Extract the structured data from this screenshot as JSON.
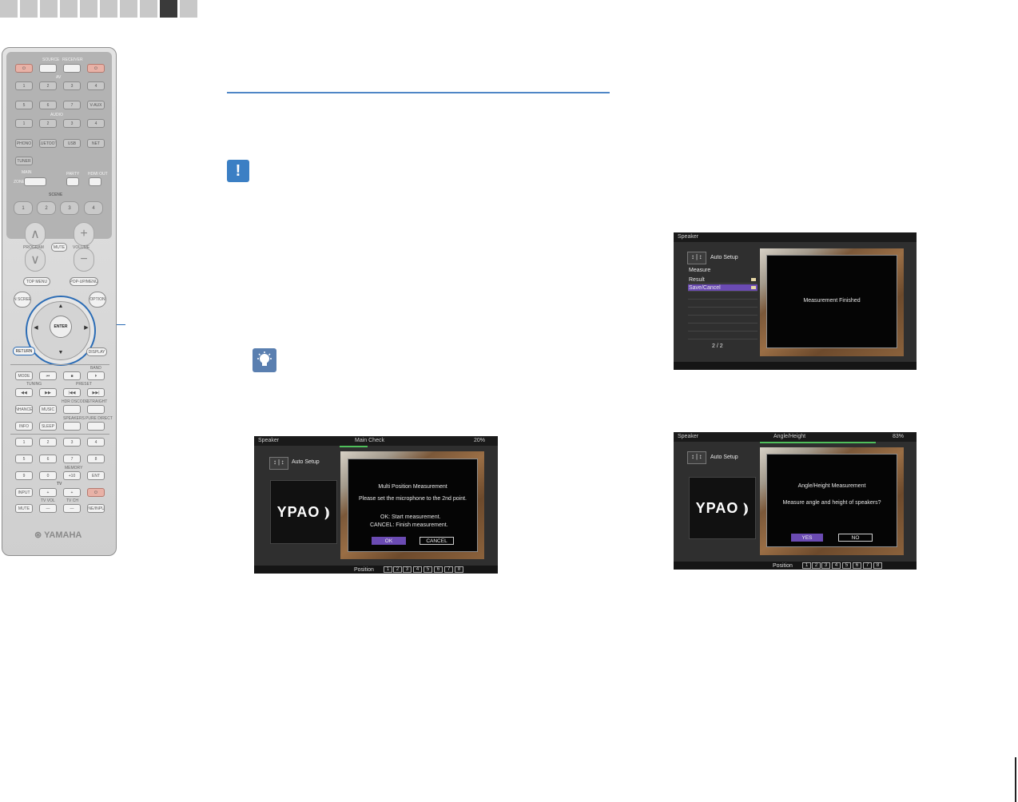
{
  "page": {
    "tabs_count": 10,
    "active_tab_index": 8,
    "accent_color": "#4f86c6"
  },
  "remote": {
    "brand": "YAMAHA",
    "labels": {
      "source": "SOURCE",
      "receiver": "RECEIVER",
      "av": "AV",
      "audio": "AUDIO",
      "scene": "SCENE",
      "program": "PROGRAM",
      "volume": "VOLUME",
      "mute": "MUTE",
      "tuning": "TUNING",
      "preset": "PRESET",
      "band": "BAND",
      "tv": "TV",
      "memory": "MEMORY",
      "tv_vol": "TV VOL",
      "tv_ch": "TV CH",
      "main": "MAIN",
      "zone": "ZONE",
      "party": "PARTY",
      "hdmi_out": "HDMI OUT",
      "hdr_dscode": "HDR DSCODE",
      "straight": "STRAIGHT",
      "speakers": "SPEAKERS",
      "pure_direct": "PURE DIRECT"
    },
    "av_buttons": [
      "1",
      "2",
      "3",
      "4",
      "5",
      "6",
      "7",
      "V-AUX"
    ],
    "audio_buttons": [
      "1",
      "2",
      "3",
      "4"
    ],
    "source_buttons": [
      "PHONO",
      "BLUETOOTH",
      "USB",
      "NET"
    ],
    "tuner_button": "TUNER",
    "scene_buttons": [
      "1",
      "2",
      "3",
      "4"
    ],
    "menu_buttons": {
      "top_menu": "TOP MENU",
      "popup_menu": "POP-UP/MENU",
      "on_screen": "ON SCREEN",
      "option": "OPTION",
      "enter": "ENTER",
      "return": "RETURN",
      "display": "DISPLAY"
    },
    "transport": [
      "MODE",
      "⏮",
      "■",
      "⏵"
    ],
    "tuning_row": [
      "◀◀",
      "▶▶",
      "|◀◀",
      "▶▶|"
    ],
    "sound_row": [
      "ENHANCER",
      "MUSIC",
      "",
      ""
    ],
    "info_row": [
      "INFO",
      "SLEEP",
      "",
      ""
    ],
    "num_rows": [
      [
        "1",
        "2",
        "3",
        "4"
      ],
      [
        "5",
        "6",
        "7",
        "8"
      ],
      [
        "9",
        "0",
        "+10",
        "ENT"
      ]
    ],
    "tv_row1": [
      "INPUT",
      "+",
      "+",
      "⏻"
    ],
    "tv_row2": [
      "MUTE",
      "—",
      "—",
      "LINE/INPUT"
    ]
  },
  "screens": {
    "left": {
      "header_left": "Speaker",
      "header_center": "Main Check",
      "header_right": "20%",
      "progress": 0.2,
      "menu_title": "Auto Setup",
      "logo": "YPAO",
      "panel_title": "Multi Position Measurement",
      "panel_line": "Please set the microphone to the 2nd point.",
      "ok_line": "OK:   Start measurement.",
      "cancel_line": "CANCEL:  Finish measurement.",
      "ok_button": "OK",
      "cancel_button": "CANCEL",
      "position_label": "Position",
      "positions": [
        "1",
        "2",
        "3",
        "4",
        "5",
        "6",
        "7",
        "8"
      ]
    },
    "top_right": {
      "header_left": "Speaker",
      "menu_title": "Auto Setup",
      "menu_items": [
        "Measure",
        "Result",
        "Save/Cancel"
      ],
      "page_indicator": "2 / 2",
      "panel_text": "Measurement Finished"
    },
    "bottom_right": {
      "header_left": "Speaker",
      "header_center": "Angle/Height",
      "header_right": "83%",
      "progress": 0.83,
      "menu_title": "Auto Setup",
      "logo": "YPAO",
      "panel_title": "Angle/Height Measurement",
      "panel_line": "Measure angle and height of speakers?",
      "yes_button": "YES",
      "no_button": "NO",
      "position_label": "Position",
      "positions": [
        "1",
        "2",
        "3",
        "4",
        "5",
        "6",
        "7",
        "8"
      ]
    }
  }
}
